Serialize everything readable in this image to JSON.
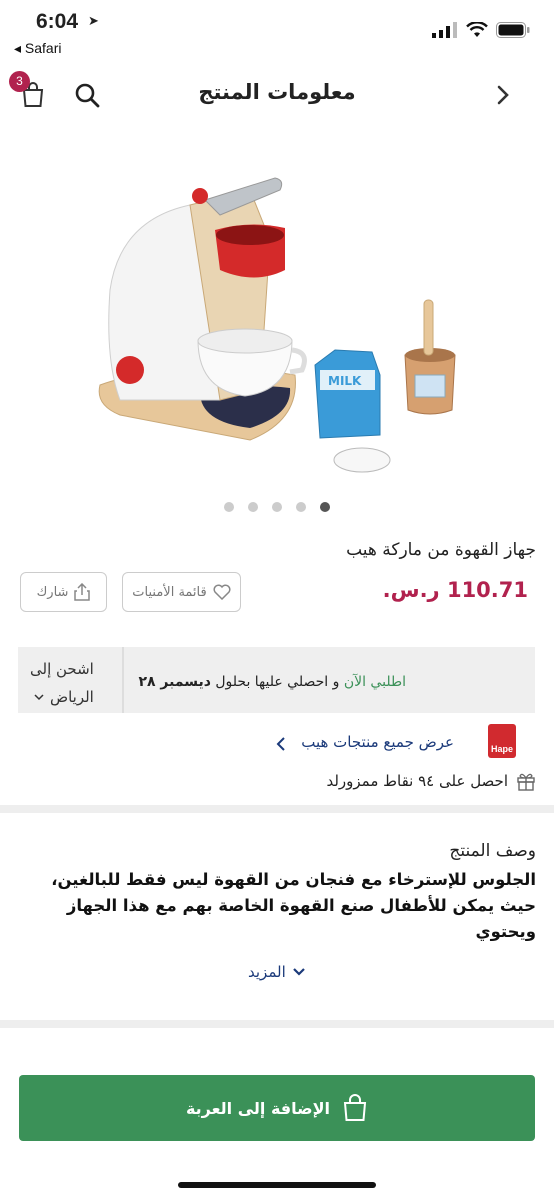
{
  "status_bar": {
    "time": "6:04",
    "back_app": "◂ Safari"
  },
  "header": {
    "title": "معلومات المنتج",
    "cart_count": "3"
  },
  "product": {
    "title": "جهاز القهوة من ماركة هيب",
    "price": "110.71 ر.س.",
    "wishlist_label": "قائمة الأمنيات",
    "share_label": "شارك",
    "gallery_dots": 5,
    "gallery_active_index": 4
  },
  "shipping": {
    "order_now": "اطلبي الآن",
    "text": " و احصلي عليها بحلول ",
    "date": "ديسمبر ٢٨",
    "ship_to_label": "اشحن إلى",
    "city": "الرياض"
  },
  "brand": {
    "logo_text": "Hape",
    "view_all": "عرض جميع منتجات هيب",
    "points": "احصل على ٩٤ نقاط ممزورلد"
  },
  "description": {
    "title": "وصف المنتج",
    "body": "الجلوس للإسترخاء مع فنجان من القهوة ليس فقط للبالغين، حيث يمكن للأطفال صنع القهوة الخاصة بهم مع هذا الجهاز ويحتوي",
    "more_label": "المزيد"
  },
  "cart_button": {
    "label": "الإضافة إلى العربة"
  },
  "colors": {
    "accent": "#b1224e",
    "green": "#3b9158",
    "link": "#1b3a7a"
  }
}
